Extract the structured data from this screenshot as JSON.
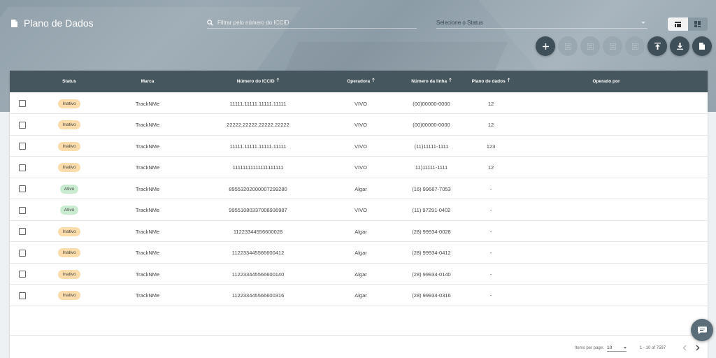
{
  "header": {
    "title": "Plano de Dados",
    "search_placeholder": "Filtrar pelo número do ICCID",
    "status_placeholder": "Selecione o Status"
  },
  "toolbar": {
    "add_icon": "plus-icon",
    "action_icons": [
      "list-icon",
      "list-icon",
      "list-icon",
      "list-icon"
    ],
    "upload_icon": "upload-icon",
    "download_icon": "download-icon",
    "document_icon": "document-icon"
  },
  "table": {
    "columns": {
      "status": "Status",
      "marca": "Marca",
      "iccid": "Número do ICCID",
      "operadora": "Operadora",
      "linha": "Número da linha",
      "plano": "Plano de dados",
      "operado_por": "Operado por"
    },
    "rows": [
      {
        "status": "Inativo",
        "marca": "TrackNMe",
        "iccid": "11111.11111.11111.11111",
        "operadora": "VIVO",
        "linha": "(00)00000-0000",
        "plano": "12",
        "operado_por": ""
      },
      {
        "status": "Inativo",
        "marca": "TrackNMe",
        "iccid": "22222.22222.22222.22222",
        "operadora": "VIVO",
        "linha": "(00)00000-0000",
        "plano": "12",
        "operado_por": ""
      },
      {
        "status": "Inativo",
        "marca": "TrackNMe",
        "iccid": "11111.11111.11111.11111",
        "operadora": "VIVO",
        "linha": "(11)11111-1111",
        "plano": "123",
        "operado_por": ""
      },
      {
        "status": "Inativo",
        "marca": "TrackNMe",
        "iccid": "11111111111111111111",
        "operadora": "VIVO",
        "linha": "11)11111-1111",
        "plano": "12",
        "operado_por": ""
      },
      {
        "status": "Ativo",
        "marca": "TrackNMe",
        "iccid": "89553202000007299280",
        "operadora": "Algar",
        "linha": "(16) 99667-7053",
        "plano": "-",
        "operado_por": ""
      },
      {
        "status": "Ativo",
        "marca": "TrackNMe",
        "iccid": "99551080337008936987",
        "operadora": "VIVO",
        "linha": "(11) 97291-0402",
        "plano": "-",
        "operado_por": ""
      },
      {
        "status": "Inativo",
        "marca": "TrackNMe",
        "iccid": "11223344556600028",
        "operadora": "Algar",
        "linha": "(28) 99934-0028",
        "plano": "-",
        "operado_por": ""
      },
      {
        "status": "Inativo",
        "marca": "TrackNMe",
        "iccid": "112233445566600412",
        "operadora": "Algar",
        "linha": "(28) 99934-0412",
        "plano": "-",
        "operado_por": ""
      },
      {
        "status": "Inativo",
        "marca": "TrackNMe",
        "iccid": "112233445566600140",
        "operadora": "Algar",
        "linha": "(28) 99934-0140",
        "plano": "-",
        "operado_por": ""
      },
      {
        "status": "Inativo",
        "marca": "TrackNMe",
        "iccid": "112233445566600316",
        "operadora": "Algar",
        "linha": "(28) 99934-0316",
        "plano": "-",
        "operado_por": ""
      }
    ]
  },
  "paginator": {
    "items_per_page_label": "Items per page:",
    "items_per_page_value": "10",
    "range_label": "1 - 10 of 7597"
  },
  "colors": {
    "header_bar": "#46565f",
    "fab_dark": "#3f4f59",
    "badge_inativo": "#fbdcaa",
    "badge_ativo": "#c9ebcf"
  }
}
